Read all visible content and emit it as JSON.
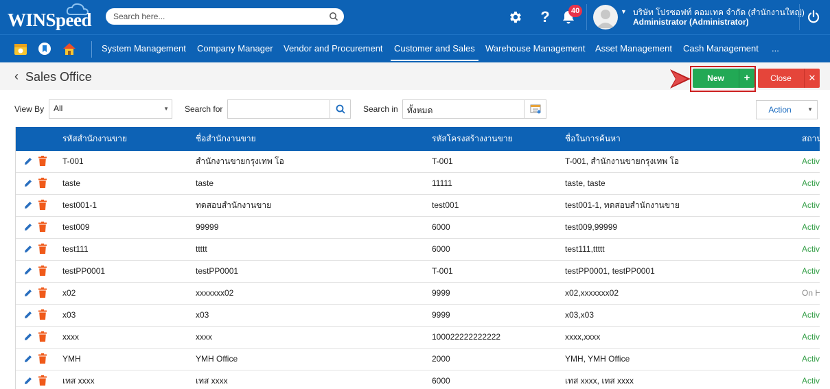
{
  "header": {
    "logo": "WINSpeed",
    "search_placeholder": "Search here...",
    "notification_count": "40",
    "company": "บริษัท โปรซอฟท์ คอมเทค จำกัด (สำนักงานใหญ่)",
    "role": "Administrator (Administrator)",
    "icons": [
      "gear-icon",
      "help-icon",
      "bell-icon",
      "avatar",
      "power-icon"
    ]
  },
  "nav": {
    "quick_icons": [
      "calendar-icon",
      "bookmark-icon",
      "home-icon"
    ],
    "items": [
      {
        "label": "System Management"
      },
      {
        "label": "Company Manager"
      },
      {
        "label": "Vendor and Procurement"
      },
      {
        "label": "Customer and Sales"
      },
      {
        "label": "Warehouse Management"
      },
      {
        "label": "Asset Management"
      },
      {
        "label": "Cash Management"
      },
      {
        "label": "..."
      }
    ],
    "active": "Customer and Sales"
  },
  "page": {
    "title": "Sales Office",
    "new_label": "New",
    "new_plus": "+",
    "close_label": "Close",
    "close_x": "✕"
  },
  "filters": {
    "view_by_label": "View By",
    "view_by_value": "All",
    "search_for_label": "Search for",
    "search_for_value": "",
    "search_in_label": "Search in",
    "search_in_value": "ทั้งหมด",
    "action_label": "Action"
  },
  "table": {
    "columns": [
      "รหัสสำนักงานขาย",
      "ชื่อสำนักงานขาย",
      "รหัสโครงสร้างงานขาย",
      "ชื่อในการค้นหา",
      "สถานะ"
    ],
    "rows": [
      {
        "code": "T-001",
        "name": "สำนักงานขายกรุงเทพ โอ",
        "struct": "T-001",
        "search": "T-001, สำนักงานขายกรุงเทพ โอ",
        "status": "Active"
      },
      {
        "code": "taste",
        "name": "taste",
        "struct": "11111",
        "search": "taste, taste",
        "status": "Active"
      },
      {
        "code": "test001-1",
        "name": "ทดสอบสำนักงานขาย",
        "struct": "test001",
        "search": "test001-1, ทดสอบสำนักงานขาย",
        "status": "Active"
      },
      {
        "code": "test009",
        "name": "99999",
        "struct": "6000",
        "search": "test009,99999",
        "status": "Active"
      },
      {
        "code": "test111",
        "name": "ttttt",
        "struct": "6000",
        "search": "test111,ttttt",
        "status": "Active"
      },
      {
        "code": "testPP0001",
        "name": "testPP0001",
        "struct": "T-001",
        "search": "testPP0001, testPP0001",
        "status": "Active"
      },
      {
        "code": "x02",
        "name": "xxxxxxx02",
        "struct": "9999",
        "search": "x02,xxxxxxx02",
        "status": "On Hold"
      },
      {
        "code": "x03",
        "name": "x03",
        "struct": "9999",
        "search": "x03,x03",
        "status": "Active"
      },
      {
        "code": "xxxx",
        "name": "xxxx",
        "struct": "100022222222222",
        "search": "xxxx,xxxx",
        "status": "Active"
      },
      {
        "code": "YMH",
        "name": "YMH Office",
        "struct": "2000",
        "search": "YMH, YMH Office",
        "status": "Active"
      },
      {
        "code": "เทส xxxx",
        "name": "เทส xxxx",
        "struct": "6000",
        "search": "เทส xxxx, เทส xxxx",
        "status": "Active"
      }
    ]
  },
  "colors": {
    "primary": "#0d62b5",
    "new_button": "#22a955",
    "close_button": "#e5453a",
    "status_active": "#37a04a",
    "delete_icon": "#f05a1a",
    "edit_icon": "#2a6fbf"
  }
}
